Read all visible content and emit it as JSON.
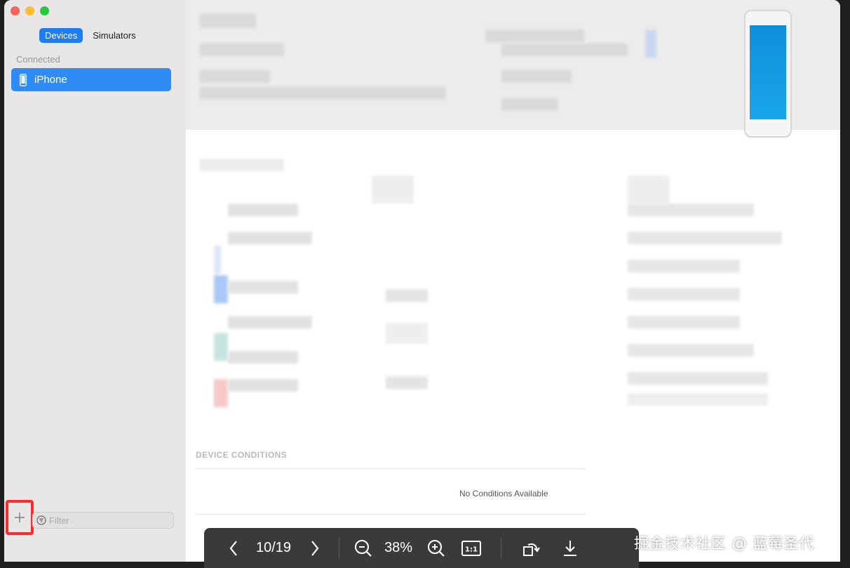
{
  "sidebar": {
    "tabs": [
      {
        "label": "Devices",
        "active": true
      },
      {
        "label": "Simulators",
        "active": false
      }
    ],
    "section_header": "Connected",
    "devices": [
      {
        "label": "iPhone",
        "selected": true
      }
    ],
    "filter_placeholder": "Filter",
    "add_icon": "plus-icon"
  },
  "main": {
    "device_conditions": {
      "title": "DEVICE CONDITIONS",
      "empty_text": "No Conditions Available"
    }
  },
  "viewer": {
    "page_indicator": "10/19",
    "zoom": "38%",
    "actual_size_label": "1:1"
  },
  "watermark": "掘金技术社区 @ 蓝莓圣代",
  "colors": {
    "accent": "#1d7cf2",
    "selection": "#2f8cf5",
    "highlight_border": "#ff2a2a"
  }
}
